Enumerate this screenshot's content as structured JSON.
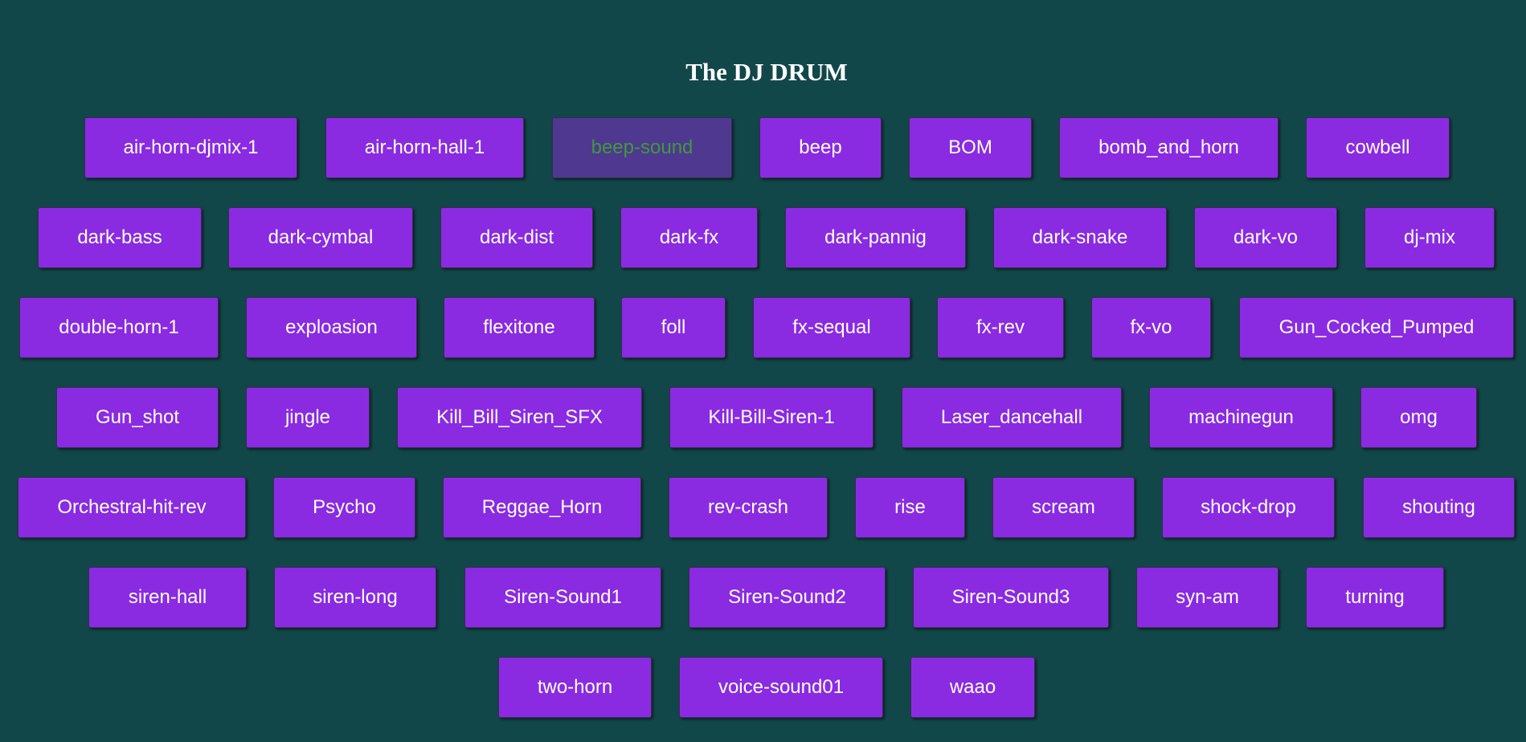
{
  "page": {
    "title": "The DJ DRUM"
  },
  "colors": {
    "background": "#12474a",
    "pad": "#8a2be2",
    "pad_text": "#ffffff",
    "pad_active": "#4f3890",
    "pad_active_text": "#3e9a3a"
  },
  "pads": [
    {
      "label": "air-horn-djmix-1",
      "active": false
    },
    {
      "label": "air-horn-hall-1",
      "active": false
    },
    {
      "label": "beep-sound",
      "active": true
    },
    {
      "label": "beep",
      "active": false
    },
    {
      "label": "BOM",
      "active": false
    },
    {
      "label": "bomb_and_horn",
      "active": false
    },
    {
      "label": "cowbell",
      "active": false
    },
    {
      "label": "dark-bass",
      "active": false
    },
    {
      "label": "dark-cymbal",
      "active": false
    },
    {
      "label": "dark-dist",
      "active": false
    },
    {
      "label": "dark-fx",
      "active": false
    },
    {
      "label": "dark-pannig",
      "active": false
    },
    {
      "label": "dark-snake",
      "active": false
    },
    {
      "label": "dark-vo",
      "active": false
    },
    {
      "label": "dj-mix",
      "active": false
    },
    {
      "label": "double-horn-1",
      "active": false
    },
    {
      "label": "exploasion",
      "active": false
    },
    {
      "label": "flexitone",
      "active": false
    },
    {
      "label": "foll",
      "active": false
    },
    {
      "label": "fx-sequal",
      "active": false
    },
    {
      "label": "fx-rev",
      "active": false
    },
    {
      "label": "fx-vo",
      "active": false
    },
    {
      "label": "Gun_Cocked_Pumped",
      "active": false
    },
    {
      "label": "Gun_shot",
      "active": false
    },
    {
      "label": "jingle",
      "active": false
    },
    {
      "label": "Kill_Bill_Siren_SFX",
      "active": false
    },
    {
      "label": "Kill-Bill-Siren-1",
      "active": false
    },
    {
      "label": "Laser_dancehall",
      "active": false
    },
    {
      "label": "machinegun",
      "active": false
    },
    {
      "label": "omg",
      "active": false
    },
    {
      "label": "Orchestral-hit-rev",
      "active": false
    },
    {
      "label": "Psycho",
      "active": false
    },
    {
      "label": "Reggae_Horn",
      "active": false
    },
    {
      "label": "rev-crash",
      "active": false
    },
    {
      "label": "rise",
      "active": false
    },
    {
      "label": "scream",
      "active": false
    },
    {
      "label": "shock-drop",
      "active": false
    },
    {
      "label": "shouting",
      "active": false
    },
    {
      "label": "siren-hall",
      "active": false
    },
    {
      "label": "siren-long",
      "active": false
    },
    {
      "label": "Siren-Sound1",
      "active": false
    },
    {
      "label": "Siren-Sound2",
      "active": false
    },
    {
      "label": "Siren-Sound3",
      "active": false
    },
    {
      "label": "syn-am",
      "active": false
    },
    {
      "label": "turning",
      "active": false
    },
    {
      "label": "two-horn",
      "active": false
    },
    {
      "label": "voice-sound01",
      "active": false
    },
    {
      "label": "waao",
      "active": false
    }
  ]
}
